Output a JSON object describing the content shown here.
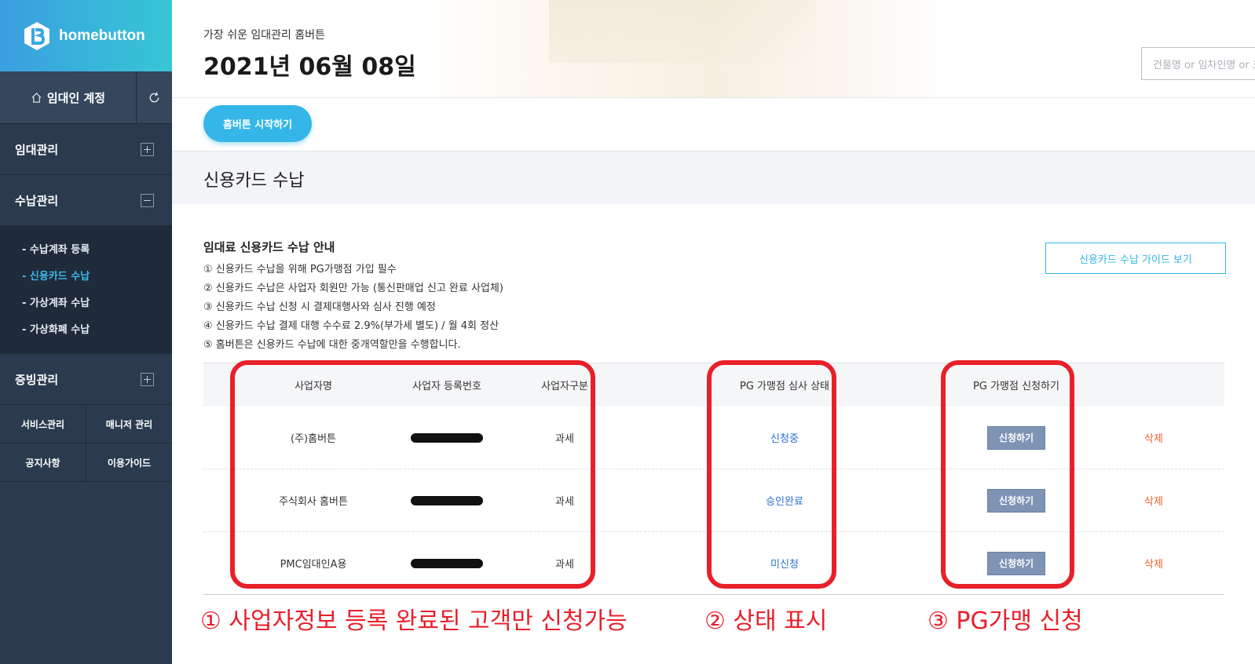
{
  "brand": {
    "name": "homebutton"
  },
  "account": {
    "label": "임대인 계정"
  },
  "sidebar": {
    "sections": [
      {
        "label": "임대관리",
        "state": "collapsed"
      },
      {
        "label": "수납관리",
        "state": "expanded"
      }
    ],
    "submenu": [
      {
        "label": "- 수납계좌 등록"
      },
      {
        "label": "- 신용카드 수납",
        "active": true
      },
      {
        "label": "- 가상계좌 수납"
      },
      {
        "label": "- 가상화폐 수납"
      }
    ],
    "section3": {
      "label": "증빙관리"
    },
    "quick": [
      {
        "label": "서비스관리"
      },
      {
        "label": "매니저 관리"
      },
      {
        "label": "공지사항"
      },
      {
        "label": "이용가이드"
      }
    ]
  },
  "header": {
    "tagline": "가장 쉬운 임대관리 홈버튼",
    "date": "2021년 06월 08일",
    "search_placeholder": "건물명 or 임차인명 or 호실"
  },
  "start_button": "홈버튼 시작하기",
  "page_title": "신용카드 수납",
  "guide": {
    "title": "임대료 신용카드 수납 안내",
    "items": [
      "① 신용카드 수납을 위해 PG가맹점 가입 필수",
      "② 신용카드 수납은 사업자 회원만 가능 (통신판매업 신고 완료 사업체)",
      "③ 신용카드 수납 신청 시 결제대행사와 심사 진행 예정",
      "④ 신용카드 수납 결제 대행 수수료 2.9%(부가세 별도) / 월 4회 정산",
      "⑤ 홈버튼은 신용카드 수납에 대한 중개역할만을 수행합니다."
    ],
    "button": "신용카드 수납 가이드 보기"
  },
  "table": {
    "headers": [
      "사업자명",
      "사업자 등록번호",
      "사업자구분",
      "PG 가맹점 심사 상태",
      "PG 가맹점 신청하기"
    ],
    "rows": [
      {
        "name": "(주)홈버튼",
        "type": "과세",
        "status": "신청중",
        "apply": "신청하기",
        "delete": "삭제"
      },
      {
        "name": "주식회사 홈버튼",
        "type": "과세",
        "status": "승인완료",
        "apply": "신청하기",
        "delete": "삭제"
      },
      {
        "name": "PMC임대인A용",
        "type": "과세",
        "status": "미신청",
        "apply": "신청하기",
        "delete": "삭제"
      }
    ]
  },
  "annotations": [
    "① 사업자정보 등록 완료된 고객만 신청가능",
    "② 상태 표시",
    "③ PG가맹 신청"
  ],
  "colors": {
    "accent": "#35b6e8",
    "annotation": "#e8202a",
    "delete": "#f0602f",
    "status": "#2a6fd6",
    "sidebar": "#2b3a4e"
  }
}
